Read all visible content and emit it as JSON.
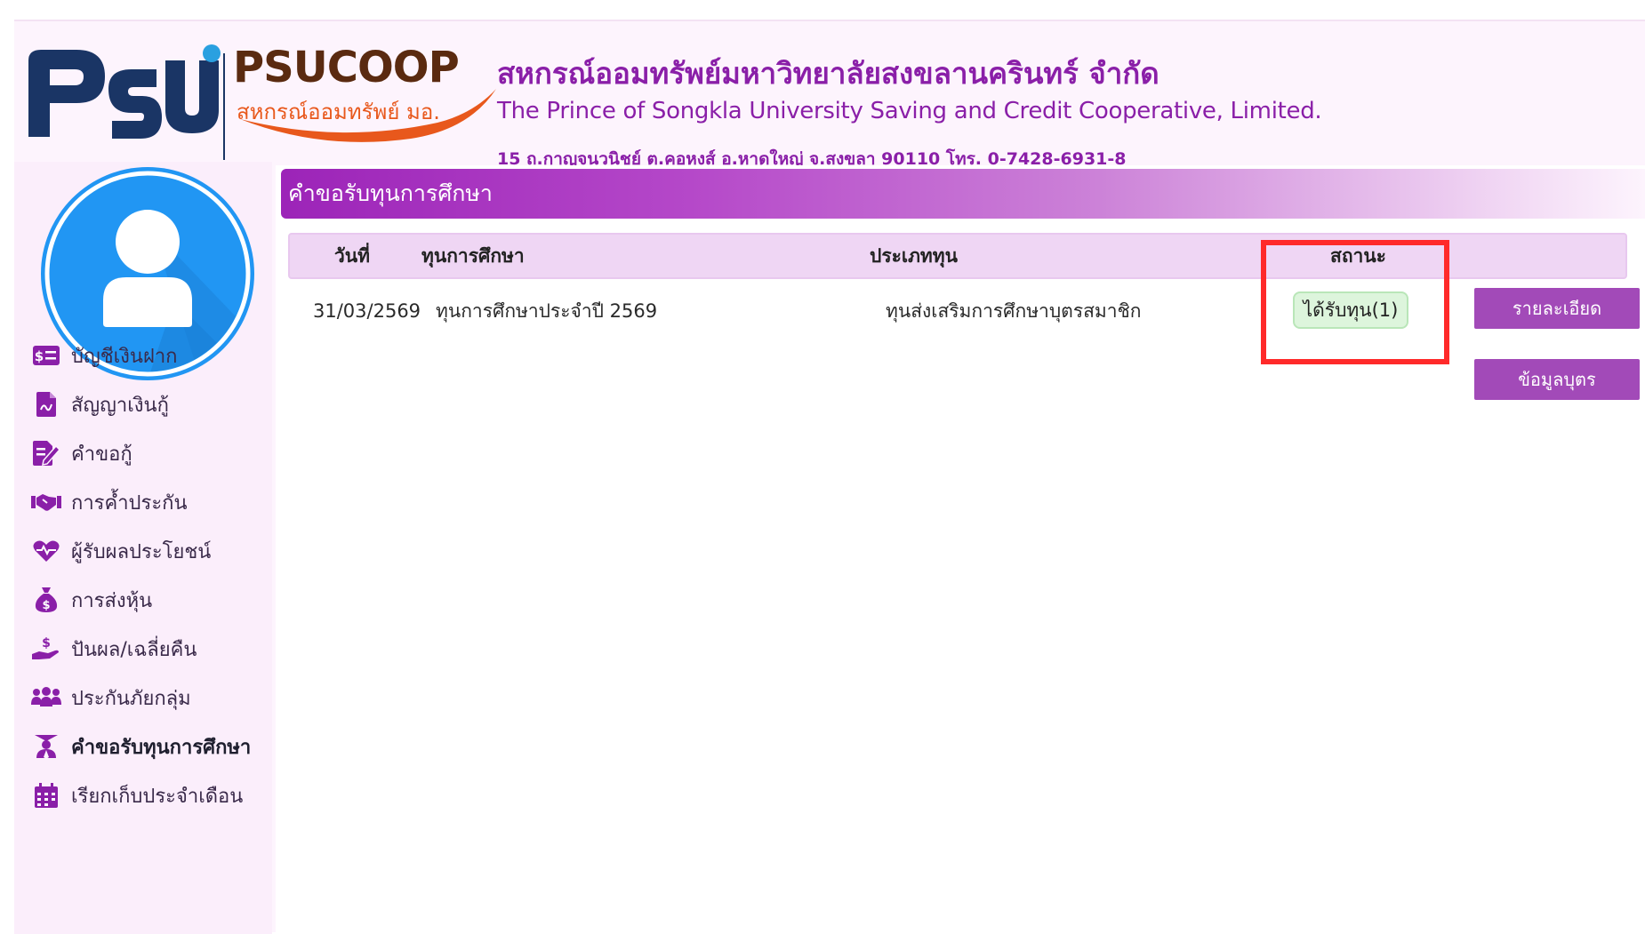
{
  "header": {
    "logo_psu_text": "PSU",
    "coop_name": "PSUCOOP",
    "coop_sub": "สหกรณ์ออมทรัพย์ มอ.",
    "org_name_th": "สหกรณ์ออมทรัพย์มหาวิทยาลัยสงขลานครินทร์ จำกัด",
    "org_name_en": "The Prince of Songkla University Saving and Credit Cooperative, Limited.",
    "address": "15 ถ.กาญจนวนิชย์ ต.คอหงส์ อ.หาดใหญ่ จ.สงขลา 90110 โทร. 0-7428-6931-8"
  },
  "sidebar": {
    "items": [
      {
        "label": "บัญชีเงินฝาก",
        "icon": "deposit-account-icon"
      },
      {
        "label": "สัญญาเงินกู้",
        "icon": "loan-contract-icon"
      },
      {
        "label": "คำขอกู้",
        "icon": "loan-request-icon"
      },
      {
        "label": "การค้ำประกัน",
        "icon": "guarantee-handshake-icon"
      },
      {
        "label": "ผู้รับผลประโยชน์",
        "icon": "beneficiary-heart-icon"
      },
      {
        "label": "การส่งหุ้น",
        "icon": "money-bag-icon"
      },
      {
        "label": "ปันผล/เฉลี่ยคืน",
        "icon": "dividend-hand-icon"
      },
      {
        "label": "ประกันภัยกลุ่ม",
        "icon": "group-insurance-icon"
      },
      {
        "label": "คำขอรับทุนการศึกษา",
        "icon": "graduation-icon",
        "active": true
      },
      {
        "label": "เรียกเก็บประจำเดือน",
        "icon": "calendar-icon"
      }
    ]
  },
  "main": {
    "title": "คำขอรับทุนการศึกษา",
    "table": {
      "headers": [
        "วันที่",
        "ทุนการศึกษา",
        "ประเภททุน",
        "สถานะ"
      ],
      "rows": [
        {
          "date": "31/03/2569",
          "scholarship": "ทุนการศึกษาประจำปี 2569",
          "type": "ทุนส่งเสริมการศึกษาบุตรสมาชิก",
          "status": "ได้รับทุน(1)"
        }
      ]
    },
    "buttons": {
      "details": "รายละเอียด",
      "child_info": "ข้อมูลบุตร"
    }
  },
  "colors": {
    "accent_purple": "#9c24b8",
    "button_purple": "#a24ab8",
    "status_green": "#ddf5dc",
    "highlight_red": "#ff2a2a",
    "psu_navy": "#1a3565",
    "psu_blue": "#2aa0e0",
    "avatar_blue": "#2196f3"
  }
}
